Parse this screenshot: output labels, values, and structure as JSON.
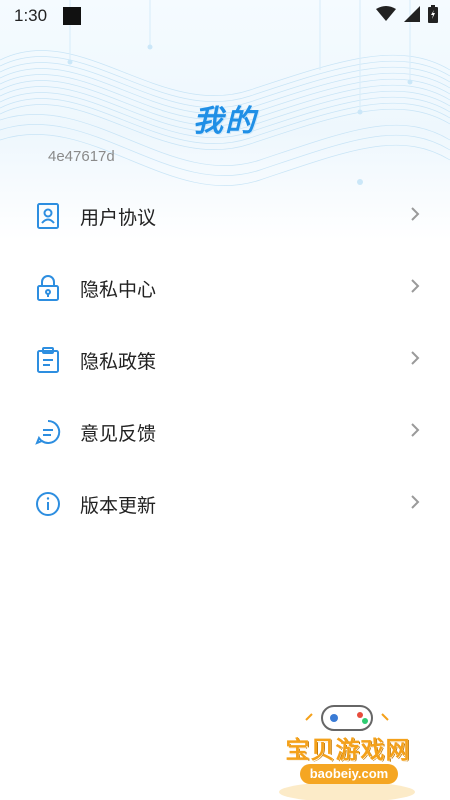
{
  "status_bar": {
    "time": "1:30"
  },
  "header": {
    "title": "我的",
    "user_id": "4e47617d"
  },
  "menu": {
    "items": [
      {
        "label": "用户协议",
        "icon": "user-card-icon"
      },
      {
        "label": "隐私中心",
        "icon": "lock-icon"
      },
      {
        "label": "隐私政策",
        "icon": "clipboard-icon"
      },
      {
        "label": "意见反馈",
        "icon": "chat-bubble-icon"
      },
      {
        "label": "版本更新",
        "icon": "info-icon"
      }
    ]
  },
  "watermark": {
    "name": "宝贝游戏网",
    "url": "baobeiy.com"
  },
  "colors": {
    "accent": "#1f8fe6",
    "icon": "#2d8ee0",
    "chevron": "#9a9a9a",
    "watermark": "#f4a11a"
  }
}
